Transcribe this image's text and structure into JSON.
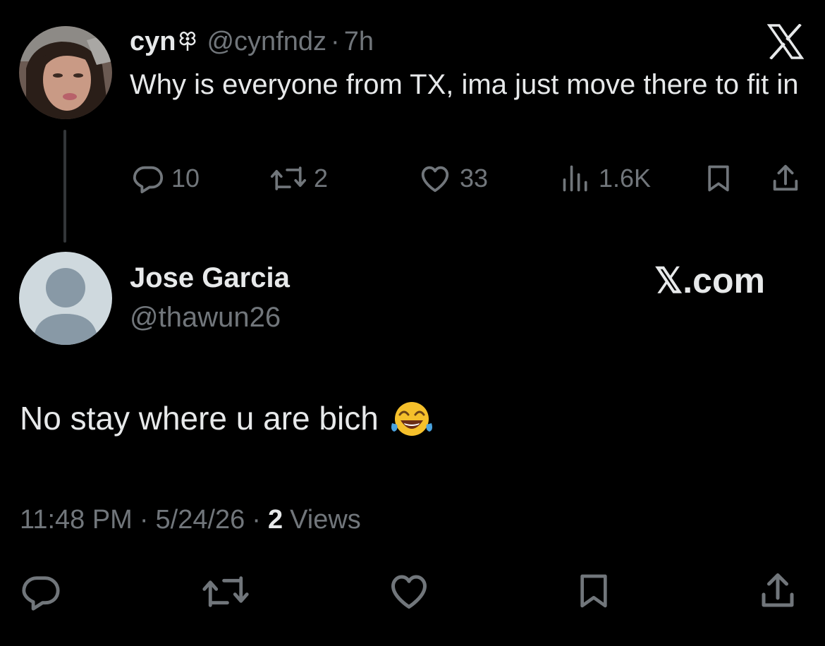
{
  "original_tweet": {
    "display_name": "cyn",
    "name_emoji": "flower-emoji",
    "handle": "@cynfndz",
    "separator": "·",
    "time_ago": "7h",
    "text": "Why is everyone from TX, ima just move there to fit in",
    "actions": {
      "replies": "10",
      "reposts": "2",
      "likes": "33",
      "views": "1.6K"
    }
  },
  "reply": {
    "display_name": "Jose Garcia",
    "handle": "@thawun26",
    "watermark": "𝕏.com",
    "text": "No stay where u are bich",
    "emoji": "face-with-tears-of-joy-emoji",
    "time": "11:48 PM",
    "separator": "·",
    "date": "5/24/26",
    "views_count": "2",
    "views_label": "Views"
  },
  "colors": {
    "background": "#000000",
    "primary_text": "#e7e9ea",
    "secondary_text": "#71767b",
    "thread_line": "#333639",
    "default_avatar_bg": "#cfd9de",
    "default_avatar_fg": "#8899a6"
  }
}
